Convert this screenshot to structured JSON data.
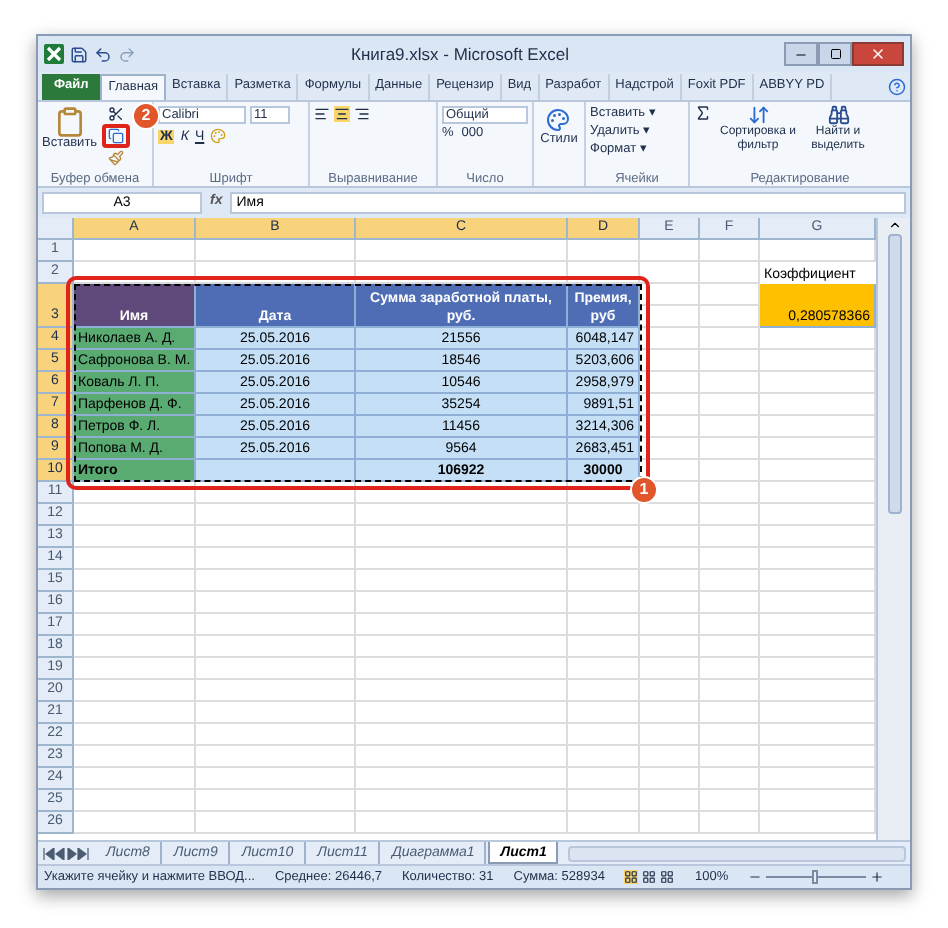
{
  "window": {
    "title": "Книга9.xlsx - Microsoft Excel"
  },
  "ribbon_tabs": [
    {
      "label": "Файл",
      "kind": "file",
      "selected": false
    },
    {
      "label": "Главная",
      "kind": "tab",
      "selected": true
    },
    {
      "label": "Вставка",
      "kind": "tab",
      "selected": false
    },
    {
      "label": "Разметка",
      "kind": "tab",
      "selected": false
    },
    {
      "label": "Формулы",
      "kind": "tab",
      "selected": false
    },
    {
      "label": "Данные",
      "kind": "tab",
      "selected": false
    },
    {
      "label": "Рецензир",
      "kind": "tab",
      "selected": false
    },
    {
      "label": "Вид",
      "kind": "tab",
      "selected": false
    },
    {
      "label": "Разработ",
      "kind": "tab",
      "selected": false
    },
    {
      "label": "Надстрой",
      "kind": "tab",
      "selected": false
    },
    {
      "label": "Foxit PDF",
      "kind": "tab",
      "selected": false
    },
    {
      "label": "ABBYY PD",
      "kind": "tab",
      "selected": false
    }
  ],
  "ribbon": {
    "clipboard": {
      "paste": "Вставить",
      "group": "Буфер обмена"
    },
    "font": {
      "name": "Calibri",
      "size": "11",
      "bold": "Ж",
      "italic": "К",
      "underline": "Ч",
      "group": "Шрифт"
    },
    "alignment": {
      "group": "Выравнивание"
    },
    "number": {
      "format": "Общий",
      "percent": "%",
      "thousands": "000",
      "group": "Число"
    },
    "styles": {
      "label": "Стили"
    },
    "cells": {
      "items": [
        "Вставить ▾",
        "Удалить ▾",
        "Формат ▾"
      ],
      "group": "Ячейки"
    },
    "editing": {
      "sort": "Сортировка и фильтр",
      "find": "Найти и выделить",
      "group": "Редактирование"
    }
  },
  "callouts": [
    "2",
    "1"
  ],
  "formula_bar": {
    "name_box": "A3",
    "function_label": "fx",
    "formula": "Имя"
  },
  "columns": [
    {
      "label": "A",
      "selected": true
    },
    {
      "label": "B",
      "selected": true
    },
    {
      "label": "C",
      "selected": true
    },
    {
      "label": "D",
      "selected": true
    },
    {
      "label": "E",
      "selected": false
    },
    {
      "label": "F",
      "selected": false
    },
    {
      "label": "G",
      "selected": false
    }
  ],
  "rows": [
    {
      "number": "1",
      "selected": false
    },
    {
      "number": "2",
      "selected": false,
      "cells": [
        {
          "kind": "plain"
        },
        {
          "kind": "plain"
        },
        {
          "kind": "plain"
        },
        {
          "kind": "plain"
        },
        {
          "kind": "plain"
        },
        {
          "kind": "plain"
        },
        {
          "kind": "label",
          "text": "Коэффициент"
        }
      ]
    },
    {
      "number": "3",
      "selected": true,
      "cells": [
        {
          "kind": "name-header",
          "text": "Имя"
        },
        {
          "kind": "header",
          "text": "Дата"
        },
        {
          "kind": "header",
          "text": "Сумма заработной платы, руб."
        },
        {
          "kind": "header",
          "text": "Премия, руб"
        },
        {
          "kind": "plain"
        },
        {
          "kind": "plain"
        },
        {
          "kind": "highlight",
          "text": "0,280578366"
        }
      ]
    },
    {
      "number": "4",
      "selected": true,
      "cells": [
        {
          "kind": "name",
          "text": "Николаев А. Д."
        },
        {
          "kind": "center",
          "text": "25.05.2016"
        },
        {
          "kind": "center",
          "text": "21556"
        },
        {
          "kind": "right",
          "text": "6048,147"
        }
      ]
    },
    {
      "number": "5",
      "selected": true,
      "cells": [
        {
          "kind": "name",
          "text": "Сафронова В. М."
        },
        {
          "kind": "center",
          "text": "25.05.2016"
        },
        {
          "kind": "center",
          "text": "18546"
        },
        {
          "kind": "right",
          "text": "5203,606"
        }
      ]
    },
    {
      "number": "6",
      "selected": true,
      "cells": [
        {
          "kind": "name",
          "text": "Коваль Л. П."
        },
        {
          "kind": "center",
          "text": "25.05.2016"
        },
        {
          "kind": "center",
          "text": "10546"
        },
        {
          "kind": "right",
          "text": "2958,979"
        }
      ]
    },
    {
      "number": "7",
      "selected": true,
      "cells": [
        {
          "kind": "name",
          "text": "Парфенов Д. Ф."
        },
        {
          "kind": "center",
          "text": "25.05.2016"
        },
        {
          "kind": "center",
          "text": "35254"
        },
        {
          "kind": "right",
          "text": "9891,51"
        }
      ]
    },
    {
      "number": "8",
      "selected": true,
      "cells": [
        {
          "kind": "name",
          "text": "Петров Ф. Л."
        },
        {
          "kind": "center",
          "text": "25.05.2016"
        },
        {
          "kind": "center",
          "text": "11456"
        },
        {
          "kind": "right",
          "text": "3214,306"
        }
      ]
    },
    {
      "number": "9",
      "selected": true,
      "cells": [
        {
          "kind": "name",
          "text": "Попова М. Д."
        },
        {
          "kind": "center",
          "text": "25.05.2016"
        },
        {
          "kind": "center",
          "text": "9564"
        },
        {
          "kind": "right",
          "text": "2683,451"
        }
      ]
    },
    {
      "number": "10",
      "selected": true,
      "cells": [
        {
          "kind": "total-name",
          "text": "Итого"
        },
        {
          "kind": "center"
        },
        {
          "kind": "total",
          "text": "106922"
        },
        {
          "kind": "total",
          "text": "30000"
        }
      ]
    },
    {
      "number": "11",
      "selected": false
    },
    {
      "number": "12",
      "selected": false
    },
    {
      "number": "13",
      "selected": false
    },
    {
      "number": "14",
      "selected": false
    },
    {
      "number": "15",
      "selected": false
    },
    {
      "number": "16",
      "selected": false
    },
    {
      "number": "17",
      "selected": false
    },
    {
      "number": "18",
      "selected": false
    },
    {
      "number": "19",
      "selected": false
    },
    {
      "number": "20",
      "selected": false
    },
    {
      "number": "21",
      "selected": false
    },
    {
      "number": "22",
      "selected": false
    },
    {
      "number": "23",
      "selected": false
    },
    {
      "number": "24",
      "selected": false
    },
    {
      "number": "25",
      "selected": false
    },
    {
      "number": "26",
      "selected": false
    }
  ],
  "sheet_tabs": [
    {
      "label": "Лист8",
      "selected": false
    },
    {
      "label": "Лист9",
      "selected": false
    },
    {
      "label": "Лист10",
      "selected": false
    },
    {
      "label": "Лист11",
      "selected": false
    },
    {
      "label": "Диаграмма1",
      "selected": false
    },
    {
      "label": "Лист1",
      "selected": true
    }
  ],
  "status_bar": {
    "message": "Укажите ячейку и нажмите ВВОД...",
    "average": "Среднее: 26446,7",
    "count": "Количество: 31",
    "sum": "Сумма: 528934",
    "views": [
      {
        "selected": true
      },
      {
        "selected": false
      },
      {
        "selected": false
      }
    ],
    "zoom": "100%",
    "zoom_slider": {
      "level": 0.5
    }
  }
}
